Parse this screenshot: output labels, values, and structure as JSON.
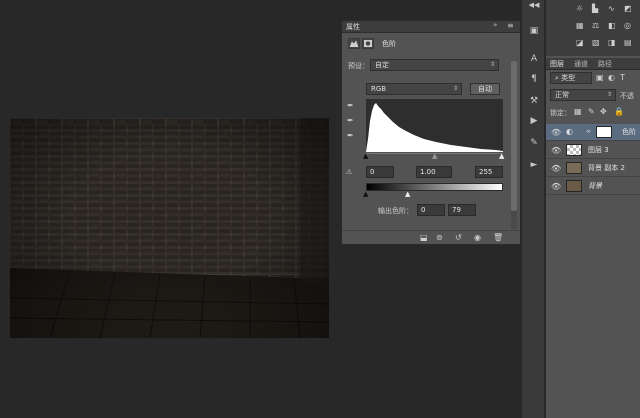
{
  "properties": {
    "tab": "属性",
    "collapse_icon": "double-chevron-right",
    "menu_icon": "panel-menu",
    "panel_title": "色阶",
    "preset_label": "预设：",
    "preset_value": "自定",
    "channel_value": "RGB",
    "auto_label": "自动",
    "input_black": "0",
    "input_gamma": "1.00",
    "input_white": "255",
    "output_label": "输出色阶：",
    "output_black": "0",
    "output_white": "79"
  },
  "layers": {
    "tabs": [
      "图层",
      "通道",
      "路径"
    ],
    "filter_label": "类型",
    "blend_mode": "正常",
    "opacity_label": "不透",
    "lock_label": "锁定：",
    "items": [
      {
        "name": "色阶",
        "selected": true
      },
      {
        "name": "图层 3",
        "selected": false
      },
      {
        "name": "背景 副本 2",
        "selected": false
      },
      {
        "name": "背景",
        "selected": false
      }
    ]
  },
  "colors": {
    "app_bg": "#282828",
    "panel_bg": "#535353",
    "selection": "#5b6c80"
  }
}
